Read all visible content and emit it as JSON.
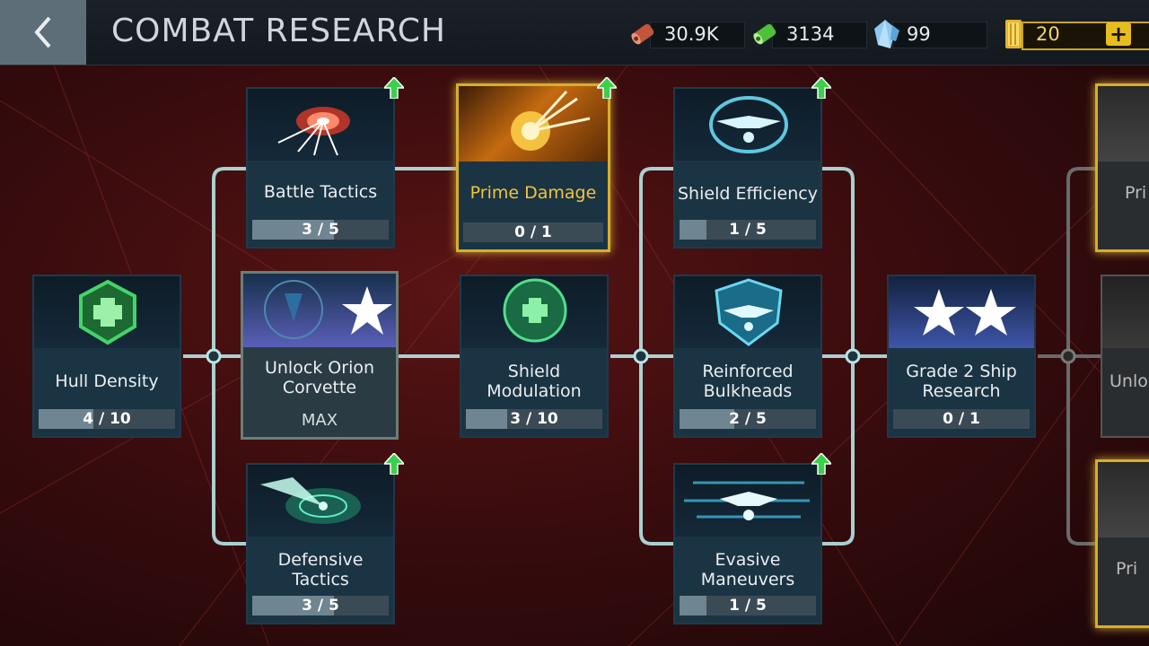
{
  "header": {
    "title": "COMBAT RESEARCH",
    "resources": [
      {
        "name": "parts-icon",
        "value": "30.9K"
      },
      {
        "name": "tritanium-icon",
        "value": "3134"
      },
      {
        "name": "crystal-icon",
        "value": "99"
      },
      {
        "name": "latinum-icon",
        "value": "20"
      }
    ],
    "add_label": "+"
  },
  "nodes": {
    "hull_density": {
      "label": "Hull Density",
      "progress": "4 / 10",
      "fraction": 0.4
    },
    "battle_tactics": {
      "label": "Battle Tactics",
      "progress": "3 / 5",
      "fraction": 0.6
    },
    "prime_damage": {
      "label": "Prime Damage",
      "progress": "0 / 1",
      "fraction": 0
    },
    "unlock_orion": {
      "label": "Unlock Orion Corvette",
      "progress": "MAX"
    },
    "defensive_tactics": {
      "label": "Defensive Tactics",
      "progress": "3 / 5",
      "fraction": 0.6
    },
    "shield_modulation": {
      "label": "Shield Modulation",
      "progress": "3 / 10",
      "fraction": 0.3
    },
    "shield_efficiency": {
      "label": "Shield Efficiency",
      "progress": "1 / 5",
      "fraction": 0.2
    },
    "reinforced_bulkheads": {
      "label": "Reinforced Bulkheads",
      "progress": "2 / 5",
      "fraction": 0.4
    },
    "evasive_maneuvers": {
      "label": "Evasive Maneuvers",
      "progress": "1 / 5",
      "fraction": 0.2
    },
    "grade2": {
      "label": "Grade 2 Ship Research",
      "progress": "0 / 1",
      "fraction": 0
    }
  },
  "partial_nodes": {
    "top": "Pri",
    "middle": "Unlo",
    "bottom": "Pri"
  },
  "colors": {
    "accent": "#b6e6e6",
    "prime": "#d7ae2c",
    "upgrade": "#38d04a"
  }
}
